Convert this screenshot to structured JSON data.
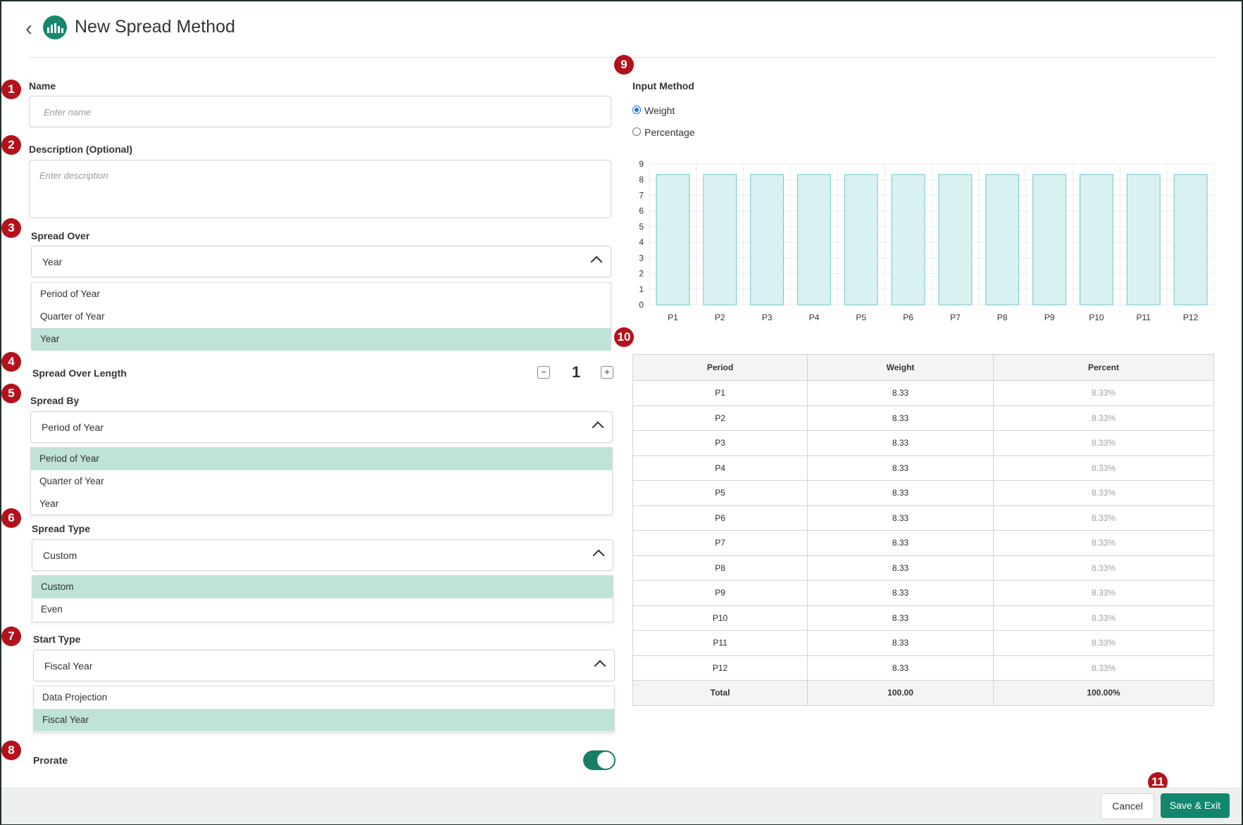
{
  "header": {
    "title": "New Spread Method",
    "back_icon": "chevron-left-icon",
    "logo_icon": "bar-chart-icon"
  },
  "badges": [
    "1",
    "2",
    "3",
    "4",
    "5",
    "6",
    "7",
    "8",
    "9",
    "10",
    "11"
  ],
  "name": {
    "label": "Name",
    "placeholder": "Enter name"
  },
  "description": {
    "label": "Description (Optional)",
    "placeholder": "Enter description"
  },
  "spread_over": {
    "label": "Spread Over",
    "value": "Year",
    "options": [
      "Period of Year",
      "Quarter of Year",
      "Year"
    ]
  },
  "spread_over_length": {
    "label": "Spread Over Length",
    "value": "1",
    "minus": "−",
    "plus": "+"
  },
  "spread_by": {
    "label": "Spread By",
    "value": "Period of Year",
    "options": [
      "Period of Year",
      "Quarter of Year",
      "Year"
    ]
  },
  "spread_type": {
    "label": "Spread Type",
    "value": "Custom",
    "options": [
      "Custom",
      "Even"
    ]
  },
  "start_type": {
    "label": "Start Type",
    "value": "Fiscal Year",
    "options": [
      "Data Projection",
      "Fiscal Year"
    ]
  },
  "prorate": {
    "label": "Prorate",
    "on": true
  },
  "input_method": {
    "label": "Input Method",
    "options": [
      "Weight",
      "Percentage"
    ],
    "selected": "Weight"
  },
  "chart_data": {
    "type": "bar",
    "categories": [
      "P1",
      "P2",
      "P3",
      "P4",
      "P5",
      "P6",
      "P7",
      "P8",
      "P9",
      "P10",
      "P11",
      "P12"
    ],
    "values": [
      8.33,
      8.33,
      8.33,
      8.33,
      8.33,
      8.33,
      8.33,
      8.33,
      8.33,
      8.33,
      8.33,
      8.33
    ],
    "yticks": [
      "0",
      "1",
      "2",
      "3",
      "4",
      "5",
      "6",
      "7",
      "8",
      "9"
    ],
    "ylim": [
      0,
      9
    ],
    "grid": true,
    "bar_fill": "#d9f1f1",
    "bar_stroke": "#6cc8c8"
  },
  "table": {
    "headers": [
      "Period",
      "Weight",
      "Percent"
    ],
    "rows": [
      [
        "P1",
        "8.33",
        "8.33%"
      ],
      [
        "P2",
        "8.33",
        "8.33%"
      ],
      [
        "P3",
        "8.33",
        "8.33%"
      ],
      [
        "P4",
        "8.33",
        "8.33%"
      ],
      [
        "P5",
        "8.33",
        "8.33%"
      ],
      [
        "P6",
        "8.33",
        "8.33%"
      ],
      [
        "P7",
        "8.33",
        "8.33%"
      ],
      [
        "P8",
        "8.33",
        "8.33%"
      ],
      [
        "P9",
        "8.33",
        "8.33%"
      ],
      [
        "P10",
        "8.33",
        "8.33%"
      ],
      [
        "P11",
        "8.33",
        "8.33%"
      ],
      [
        "P12",
        "8.33",
        "8.33%"
      ]
    ],
    "total": [
      "Total",
      "100.00",
      "100.00%"
    ]
  },
  "footer": {
    "cancel": "Cancel",
    "save": "Save & Exit"
  },
  "colors": {
    "accent": "#12876e",
    "badge": "#b3121c",
    "selected_option": "#bfe2d9"
  }
}
